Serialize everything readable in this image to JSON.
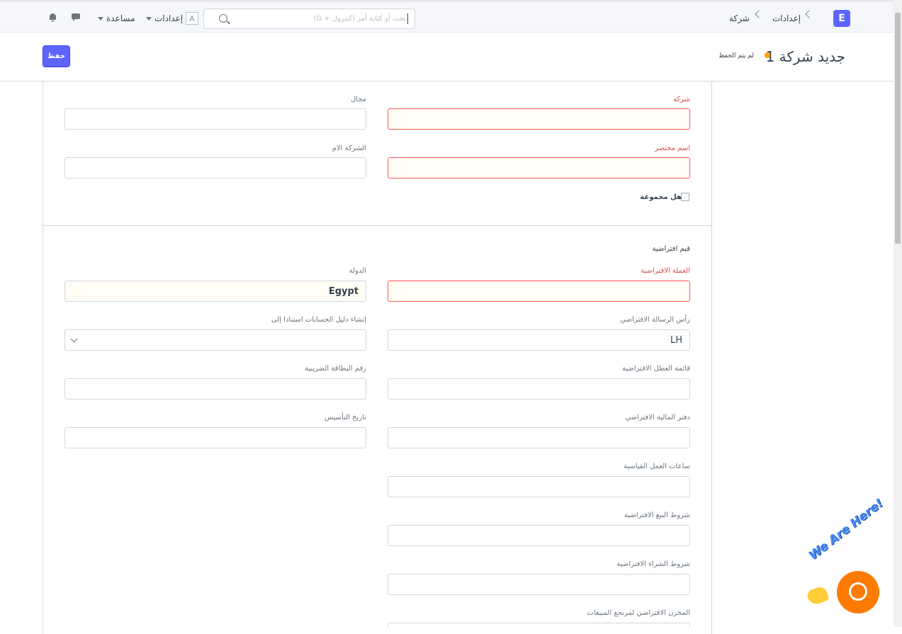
{
  "topbar": {
    "logo_letter": "E",
    "breadcrumb": [
      "إعدادات",
      "شركة"
    ],
    "search_placeholder": "بحث أو كتابة أمر (كنترول + G)",
    "avatar_letter": "A",
    "settings_label": "إعدادات",
    "help_label": "مساعدة"
  },
  "page": {
    "title": "جديد شركة 1",
    "status": "لم يتم الحفظ",
    "status_color": "#ff9f00",
    "save_label": "حفظ"
  },
  "form": {
    "company_label": "شركة",
    "company_value": "",
    "domain_label": "مجال",
    "domain_value": "",
    "abbr_label": "اسم مختصر",
    "abbr_value": "",
    "parent_label": "الشركة الام",
    "parent_value": "",
    "is_group_label": "هل مجموعة",
    "is_group_checked": false,
    "section_title": "قيم افتراضية",
    "currency_label": "العملة الافتراضية",
    "currency_value": "",
    "country_label": "الدولة",
    "country_value": "Egypt",
    "letterhead_label": "رأس الرسالة الافتراضي",
    "letterhead_value": "LH",
    "coa_label": "إنشاء دليل الحسابات استنادا إلى",
    "coa_value": "",
    "holiday_label": "قائمة العطل الافتراضية",
    "tax_id_label": "رقم البطاقة الضريبية",
    "finance_book_label": "دفتر المالية الافتراضي",
    "founded_label": "تاريخ التأسيس",
    "std_hours_label": "ساعات العمل القياسية",
    "selling_terms_label": "شروط البيع الافتراضية",
    "buying_terms_label": "شروط الشراء الافتراضية",
    "return_wh_label": "المخزن الافتراضي لمرتجع المبيعات"
  },
  "chat_widget": {
    "label": "We Are Here!",
    "color": "#ff7a00"
  }
}
